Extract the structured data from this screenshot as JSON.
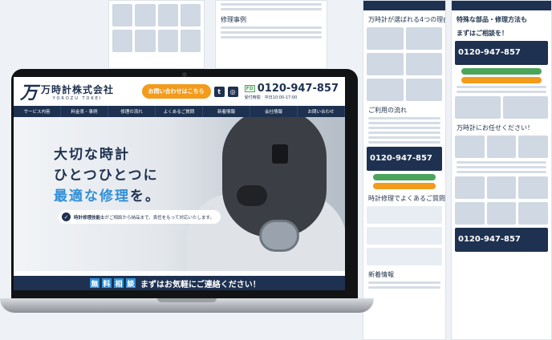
{
  "company": {
    "logo_mark": "万",
    "name": "万時計株式会社",
    "name_en": "YOROZU TOKEI"
  },
  "header": {
    "cta_label": "お問い合わせはこちら",
    "twitter_icon": "t",
    "instagram_icon": "◎",
    "freedial": "FD",
    "phone": "0120-947-857",
    "hours": "受付時間　平日10:00-17:00"
  },
  "nav": [
    "サービス内容",
    "料金表・事例",
    "修理の流れ",
    "よくあるご質問",
    "新着情報",
    "会社情報",
    "お問い合わせ"
  ],
  "hero": {
    "line1": "大切な時計",
    "line2": "ひとつひとつに",
    "line3_blue": "最適な修理",
    "line3_rest": "を。",
    "tag_icon": "✓",
    "tag_bold": "時計修理技能士",
    "tag_rest": "がご相談から納品まで、責任をもって対応いたします。"
  },
  "band": {
    "chars": [
      "無",
      "料",
      "相",
      "談"
    ],
    "text": "まずはお気軽にご連絡ください！"
  },
  "bg": {
    "reasons": "万時計が選ばれる4つの理由",
    "repair": "修理事例",
    "flow": "ご利用の流れ",
    "faq": "時計修理でよくあるご質問",
    "news": "新着情報",
    "special": "特殊な部品・修理方法も",
    "consult": "まずはご相談を！",
    "phone": "0120-947-857",
    "leave": "万時計にお任せください！"
  },
  "colors": {
    "navy": "#1e3150",
    "accent_blue": "#2f8fd8",
    "orange": "#f29b1c",
    "green": "#4aa55a"
  }
}
